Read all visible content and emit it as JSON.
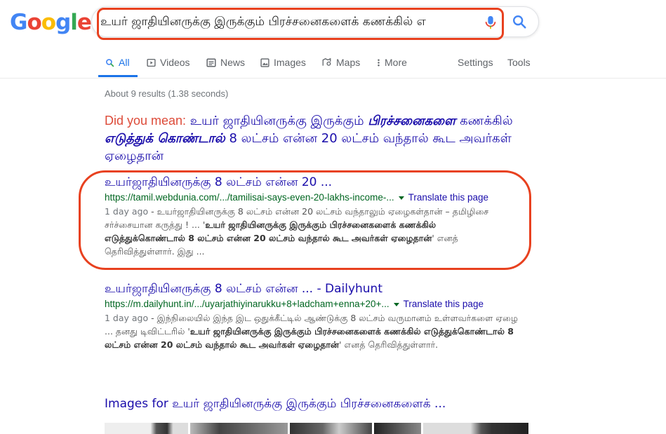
{
  "logo": {
    "letters": [
      "G",
      "o",
      "o",
      "g",
      "l",
      "e"
    ],
    "colors": [
      "#4285f4",
      "#ea4335",
      "#fbbc05",
      "#4285f4",
      "#34a853",
      "#ea4335"
    ]
  },
  "search": {
    "query": "உயர் ஜாதியினருக்கு இருக்கும் பிரச்சனைகளைக் கணக்கில் எ"
  },
  "tabs": [
    {
      "label": "All",
      "icon": "search-icon"
    },
    {
      "label": "Videos",
      "icon": "play-icon"
    },
    {
      "label": "News",
      "icon": "newspaper-icon"
    },
    {
      "label": "Images",
      "icon": "image-icon"
    },
    {
      "label": "Maps",
      "icon": "map-pin-icon"
    },
    {
      "label": "More",
      "icon": "more-vertical-icon"
    }
  ],
  "tools": {
    "settings": "Settings",
    "tools": "Tools"
  },
  "stats": "About 9 results (1.38 seconds)",
  "did_you_mean": {
    "label": "Did you mean:",
    "part1": "உயர் ஜாதியினருக்கு இருக்கும்",
    "bold1": "பிரச்சனைகளை",
    "part2": "கணக்கில்",
    "bold2": "எடுத்துக் கொண்டால்",
    "part3": "8 லட்சம் என்ன 20 லட்சம் வந்தால் கூட அவர்கள் ஏழைதான்"
  },
  "results": [
    {
      "title": "உயர்ஜாதியினருக்கு 8 லட்சம் என்ன 20 ...",
      "url": "https://tamil.webdunia.com/.../tamilisai-says-even-20-lakhs-income-...",
      "translate": "Translate this page",
      "date": "1 day ago",
      "sep": " - ",
      "snippet_a": "உயர்ஜாதியினருக்கு 8 லட்சம் என்ன 20 லட்சம் வந்தாலும் ஏழைகள்தான் – தமிழிசை சர்ச்சையான கருத்து ! ... '",
      "snippet_bold": "உயர் ஜாதியினருக்கு இருக்கும் பிரச்சனைகளைக் கணக்கில் எடுத்துக்கொண்டால் 8 லட்சம் என்ன 20 லட்சம் வந்தால் கூட அவர்கள் ஏழைதான்",
      "snippet_b": "' எனத் தெரிவித்துள்ளார். இது ..."
    },
    {
      "title": "உயர்ஜாதியினருக்கு 8 லட்சம் என்ன ... - Dailyhunt",
      "url": "https://m.dailyhunt.in/.../uyarjathiyinarukku+8+ladcham+enna+20+...",
      "translate": "Translate this page",
      "date": "1 day ago",
      "sep": " - ",
      "snippet_a": "இந்நிலையில் இந்த இட ஒதுக்கீட்டில் ஆண்டுக்கு 8 லட்சம் வருமானம் உள்ளவர்களை ஏழை ... தனது டிவிட்டரில் '",
      "snippet_bold": "உயர் ஜாதியினருக்கு இருக்கும் பிரச்சனைகளைக் கணக்கில் எடுத்துக்கொண்டால் 8 லட்சம் என்ன 20 லட்சம் வந்தால் கூட அவர்கள் ஏழைதான்",
      "snippet_b": "' எனத் தெரிவித்துள்ளார்."
    }
  ],
  "images_heading": "Images for உயர் ஜாதியினருக்கு இருக்கும் பிரச்சனைகளைக் ..."
}
